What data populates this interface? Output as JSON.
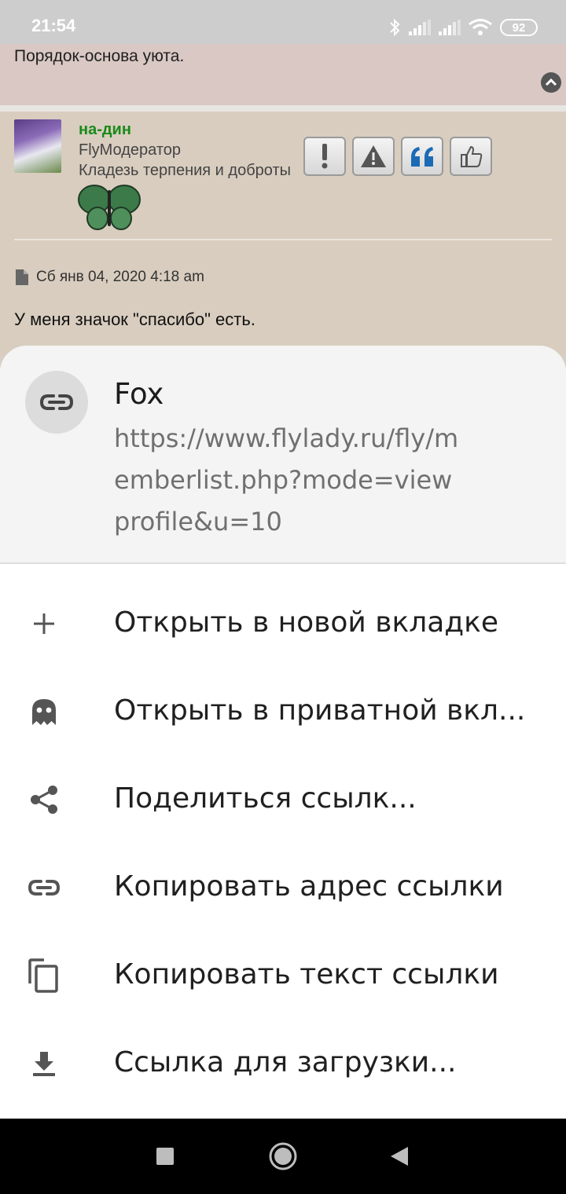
{
  "status_bar": {
    "time": "21:54",
    "battery": "92",
    "icons": [
      "bluetooth-icon",
      "signal-icon",
      "signal-icon",
      "wifi-icon",
      "battery-icon"
    ]
  },
  "page": {
    "previous_post_text": "Порядок-основа уюта.",
    "post": {
      "author_name": "на-дин",
      "author_rank": "FlyМодератор",
      "author_motto": "Кладезь терпения и доброты",
      "date": "Сб янв 04, 2020 4:18 am",
      "body": "У меня значок \"спасибо\" есть."
    },
    "author_name_color": "#1a8a1a"
  },
  "context_menu": {
    "link_title": "Fox",
    "link_url": "https://www.flylady.ru/fly/memberlist.php?mode=viewprofile&u=10",
    "items": [
      {
        "icon": "plus-icon",
        "label": "Открыть в новой вкладке"
      },
      {
        "icon": "ghost-icon",
        "label": "Открыть в приватной вкл..."
      },
      {
        "icon": "share-icon",
        "label": "Поделиться ссылк..."
      },
      {
        "icon": "link-icon",
        "label": "Копировать адрес ссылки"
      },
      {
        "icon": "copy-icon",
        "label": "Копировать текст ссылки"
      },
      {
        "icon": "download-icon",
        "label": "Ссылка для загрузки..."
      }
    ]
  },
  "nav_bar": {
    "buttons": [
      "recents-button",
      "home-button",
      "back-button"
    ]
  }
}
